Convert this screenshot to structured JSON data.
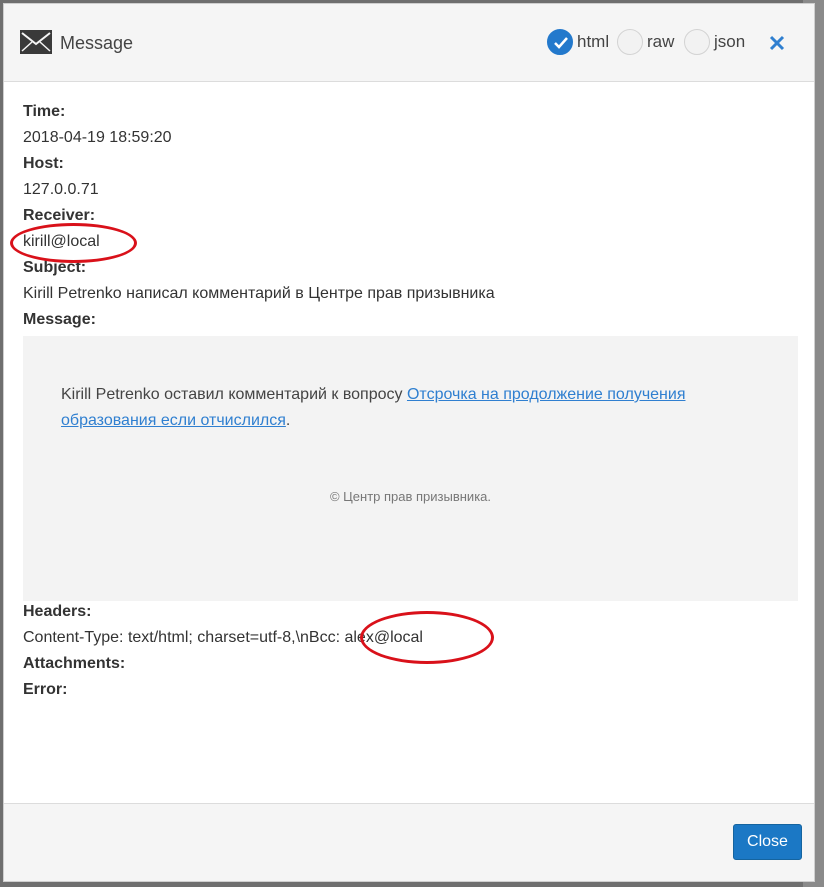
{
  "header": {
    "title": "Message",
    "formats": [
      {
        "label": "html",
        "selected": true
      },
      {
        "label": "raw",
        "selected": false
      },
      {
        "label": "json",
        "selected": false
      }
    ]
  },
  "fields": {
    "time_label": "Time:",
    "time_value": "2018-04-19 18:59:20",
    "host_label": "Host:",
    "host_value": "127.0.0.71",
    "receiver_label": "Receiver:",
    "receiver_value": "kirill@local",
    "subject_label": "Subject:",
    "subject_value": "Kirill Petrenko написал комментарий в Центре прав призывника",
    "message_label": "Message:",
    "headers_label": "Headers:",
    "headers_value": "Content-Type: text/html; charset=utf-8,\\nBcc: alex@local",
    "attachments_label": "Attachments:",
    "error_label": "Error:"
  },
  "message": {
    "intro": "Kirill Petrenko оставил комментарий к вопросу ",
    "link": "Отсрочка на продолжение получения образования если отчислился",
    "after_link": ".",
    "footer": "© Центр прав призывника."
  },
  "footer": {
    "close_label": "Close"
  },
  "colors": {
    "accent": "#1b78c5",
    "annotation": "#d9111a",
    "link": "#2f7fd0"
  }
}
